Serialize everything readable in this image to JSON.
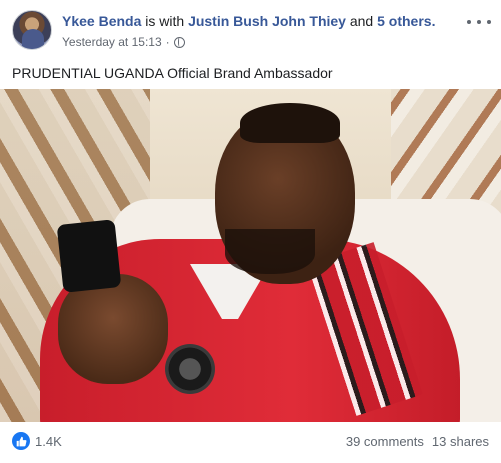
{
  "post": {
    "author": "Ykee Benda",
    "with_text": " is with ",
    "tagged": "Justin Bush John Thiey",
    "others_text": " and ",
    "others": "5 others.",
    "timestamp": "Yesterday at 15:13",
    "separator": "·",
    "audience_icon": "globe-icon",
    "caption": "PRUDENTIAL UGANDA Official Brand Ambassador"
  },
  "footer": {
    "reaction_icon": "like-icon",
    "reaction_count": "1.4K",
    "comments": "39 comments",
    "shares": "13 shares"
  },
  "colors": {
    "link": "#385898",
    "like": "#1877f2",
    "meta": "#616770"
  }
}
